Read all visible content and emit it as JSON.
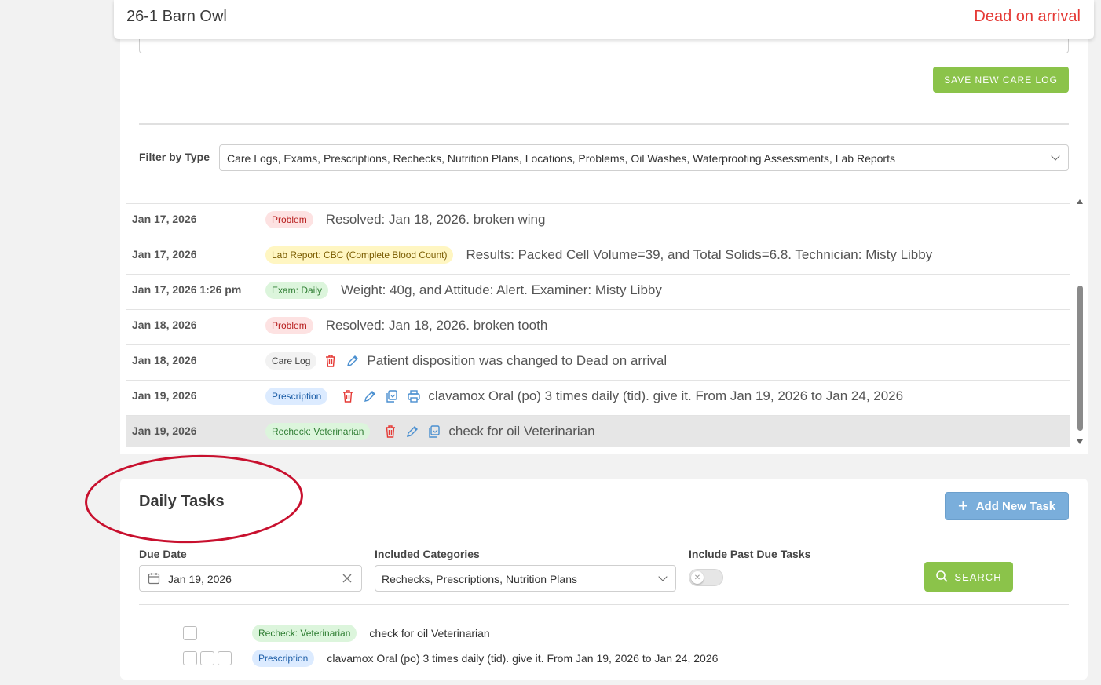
{
  "header": {
    "patient_name": "26-1 Barn Owl",
    "disposition": "Dead on arrival"
  },
  "care_log": {
    "save_label": "SAVE NEW CARE LOG",
    "filter_label": "Filter by Type",
    "filter_value": "Care Logs, Exams, Prescriptions, Rechecks, Nutrition Plans, Locations, Problems, Oil Washes, Waterproofing Assessments, Lab Reports"
  },
  "timeline": [
    {
      "date": "Jan 17, 2026",
      "badge": "Problem",
      "text": "Resolved: Jan 18, 2026. broken wing"
    },
    {
      "date": "Jan 17, 2026",
      "badge": "Lab Report: CBC (Complete Blood Count)",
      "text": "Results: Packed Cell Volume=39, and Total Solids=6.8. Technician: Misty Libby"
    },
    {
      "date": "Jan 17, 2026 1:26 pm",
      "badge": "Exam: Daily",
      "text": "Weight: 40g, and Attitude: Alert. Examiner: Misty Libby"
    },
    {
      "date": "Jan 18, 2026",
      "badge": "Problem",
      "text": "Resolved: Jan 18, 2026. broken tooth"
    },
    {
      "date": "Jan 18, 2026",
      "badge": "Care Log",
      "text": "Patient disposition was changed to Dead on arrival"
    },
    {
      "date": "Jan 19, 2026",
      "badge": "Prescription",
      "text": "clavamox Oral (po) 3 times daily (tid). give it. From Jan 19, 2026 to Jan 24, 2026"
    },
    {
      "date": "Jan 19, 2026",
      "badge": "Recheck: Veterinarian",
      "text": "check for oil Veterinarian"
    }
  ],
  "daily_tasks": {
    "title": "Daily Tasks",
    "add_label": "Add New Task",
    "due_date_label": "Due Date",
    "due_date_value": "Jan 19, 2026",
    "categories_label": "Included Categories",
    "categories_value": "Rechecks, Prescriptions, Nutrition Plans",
    "past_due_label": "Include Past Due Tasks",
    "past_due_enabled": false,
    "search_label": "SEARCH",
    "tasks": [
      {
        "badge": "Recheck: Veterinarian",
        "text": "check for oil Veterinarian",
        "checkboxes": 1
      },
      {
        "badge": "Prescription",
        "text": "clavamox Oral (po) 3 times daily (tid). give it. From Jan 19, 2026 to Jan 24, 2026",
        "checkboxes": 3
      }
    ]
  },
  "colors": {
    "accent_green": "#8bc34a",
    "accent_blue": "#7aaedb",
    "danger_red": "#e53935",
    "annotation_red": "#c8102e"
  }
}
